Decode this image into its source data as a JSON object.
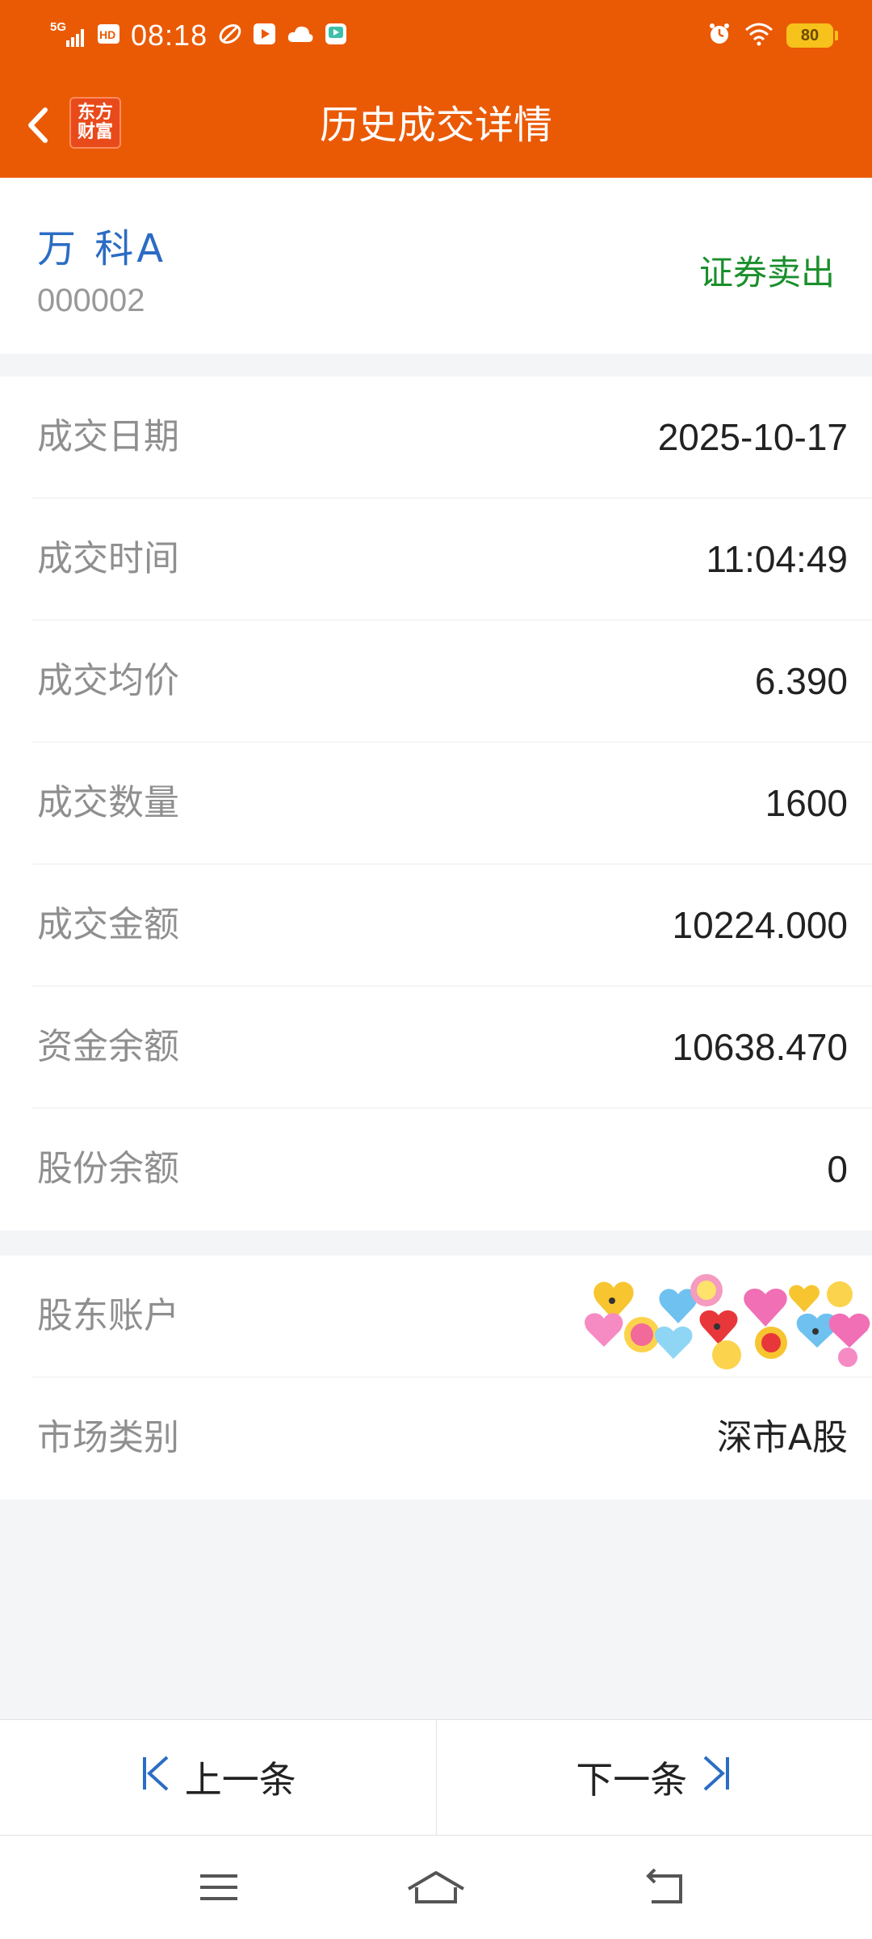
{
  "status_bar": {
    "signal": "5G",
    "hd": "HD",
    "time": "08:18",
    "battery": "80"
  },
  "app_bar": {
    "logo_line1": "东方",
    "logo_line2": "财富",
    "title": "历史成交详情"
  },
  "stock": {
    "name": "万 科A",
    "code": "000002",
    "trade_type": "证券卖出"
  },
  "details": [
    {
      "label": "成交日期",
      "value": "2025-10-17"
    },
    {
      "label": "成交时间",
      "value": "11:04:49"
    },
    {
      "label": "成交均价",
      "value": "6.390"
    },
    {
      "label": "成交数量",
      "value": "1600"
    },
    {
      "label": "成交金额",
      "value": "10224.000"
    },
    {
      "label": "资金余额",
      "value": "10638.470"
    },
    {
      "label": "股份余额",
      "value": "0"
    }
  ],
  "account": [
    {
      "label": "股东账户",
      "value": ""
    },
    {
      "label": "市场类别",
      "value": "深市A股"
    }
  ],
  "bottom_nav": {
    "prev": "上一条",
    "next": "下一条"
  },
  "colors": {
    "brand": "#ea5a05",
    "stock_name": "#2b6cc4",
    "sell": "#1a8f2c",
    "nav_arrow": "#2b6cc4"
  },
  "icons": [
    "back-arrow-icon",
    "menu-icon",
    "home-icon",
    "return-icon",
    "first-item-icon",
    "last-item-icon"
  ]
}
